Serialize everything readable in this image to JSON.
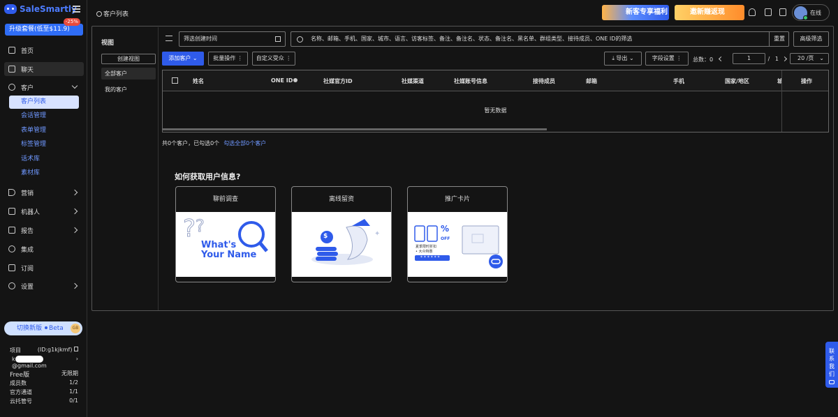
{
  "brand": {
    "name": "SaleSmartly"
  },
  "upgrade": {
    "label": "升级套餐(低至$11.9)",
    "badge": "-25%"
  },
  "nav": {
    "home": "首页",
    "chat": "聊天",
    "customer": "客户",
    "customer_sub": [
      "客户列表",
      "会话管理",
      "表单管理",
      "标签管理",
      "话术库",
      "素材库"
    ],
    "marketing": "营销",
    "robot": "机器人",
    "report": "报告",
    "integration": "集成",
    "subscription": "订阅",
    "settings": "设置"
  },
  "beta": {
    "label": "切换新版",
    "tag": "Beta",
    "coin": "GB"
  },
  "account": {
    "project_label": "项目",
    "project_id": "(ID:g1kjkmf)",
    "email_suffix": "@gmail.com",
    "email_prefix": "k",
    "plan": "Free版",
    "plan_period": "无限期",
    "stats": [
      {
        "label": "成员数",
        "value": "1/2"
      },
      {
        "label": "官方通道",
        "value": "1/1"
      },
      {
        "label": "云托管号",
        "value": "0/1"
      }
    ]
  },
  "topbar": {
    "breadcrumb": "客户列表",
    "promo1": "新客专享福利",
    "promo2": "邀新赚返现",
    "status": "在线"
  },
  "views": {
    "title": "视图",
    "create": "创建视图",
    "items": [
      "全部客户",
      "我的客户"
    ]
  },
  "filter": {
    "date_placeholder": "筛选创建时间",
    "search_placeholder": "名称、邮箱、手机、国家、城市、语言、访客标签、备注、备注名、状态、备注名、黑名单、群组类型、接待成员、ONE ID的筛选",
    "reset": "重置",
    "advanced": "高级筛选"
  },
  "toolbar": {
    "add": "添加客户",
    "batch": "批量操作",
    "audience": "自定义受众",
    "export": "导出",
    "fields": "字段设置",
    "total_label": "总数：",
    "total": "0",
    "page": "1",
    "page_sep": "/",
    "page_total": "1",
    "page_size": "20 /页"
  },
  "table": {
    "columns": [
      "姓名",
      "ONE ID",
      "社媒官方ID",
      "社媒渠道",
      "社媒账号信息",
      "接待成员",
      "邮箱",
      "手机",
      "国家/地区",
      "城市",
      "操作"
    ],
    "empty": "暂无数据"
  },
  "summary": {
    "text": "共0个客户，已勾选0个",
    "link": "勾选全部0个客户"
  },
  "howto": {
    "title": "如何获取用户信息?",
    "cards": [
      {
        "title": "聊前调查",
        "line1": "What's",
        "line2": "Your Name"
      },
      {
        "title": "离线留资",
        "coin": "$"
      },
      {
        "title": "推广卡片",
        "discount": "%",
        "off": "OFF",
        "tag1": "夏季限时折扣",
        "tag2": "• 大众特惠 ",
        "stars": "* * * * * *"
      }
    ]
  },
  "contact": {
    "label": "联系我们"
  }
}
